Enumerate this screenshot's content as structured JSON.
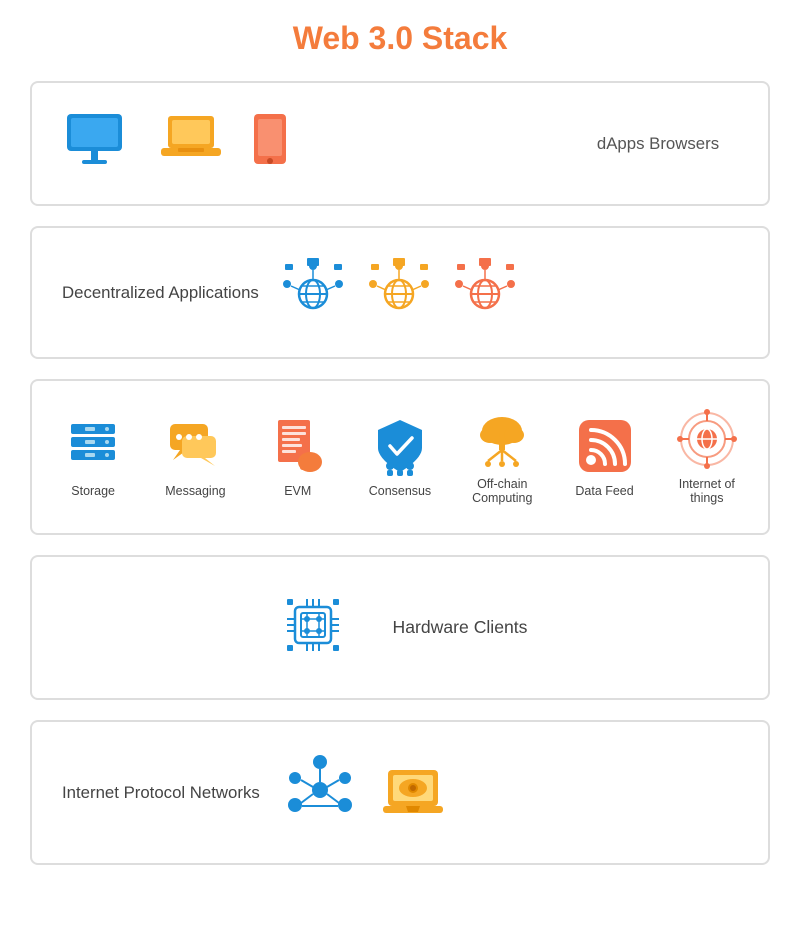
{
  "title": "Web 3.0 Stack",
  "sections": [
    {
      "id": "dapps-browsers",
      "label": "dApps Browsers",
      "layout": "icons-then-label"
    },
    {
      "id": "decentralized-apps",
      "label": "Decentralized Applications",
      "layout": "label-then-icons"
    },
    {
      "id": "services",
      "label": "",
      "layout": "icons-with-labels"
    },
    {
      "id": "hardware-clients",
      "label": "Hardware Clients",
      "layout": "icon-then-label"
    },
    {
      "id": "ip-networks",
      "label": "Internet Protocol Networks",
      "layout": "label-then-icons"
    }
  ],
  "services_labels": {
    "storage": "Storage",
    "messaging": "Messaging",
    "evm": "EVM",
    "consensus": "Consensus",
    "offchain": "Off-chain\nComputing",
    "datafeed": "Data Feed",
    "iot": "Internet of\nthings"
  }
}
